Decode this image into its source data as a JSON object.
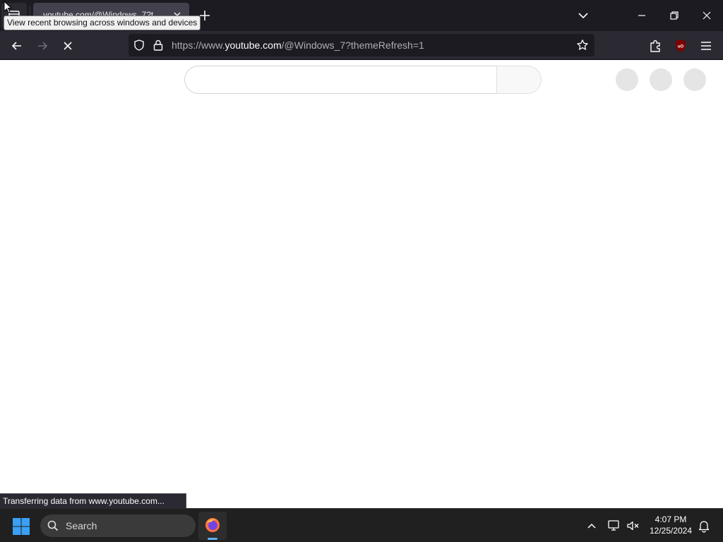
{
  "browser": {
    "tab": {
      "title": "youtube.com/@Windows_7?t"
    },
    "tooltip": "View recent browsing across windows and devices",
    "url": {
      "prefix": "https://www.",
      "host": "youtube.com",
      "path": "/@Windows_7?themeRefresh=1"
    },
    "status_text": "Transferring data from www.youtube.com..."
  },
  "taskbar": {
    "search_label": "Search",
    "time": "4:07 PM",
    "date": "12/25/2024"
  },
  "colors": {
    "tabbar_bg": "#1c1b22",
    "toolbar_bg": "#2b2a33",
    "taskbar_bg": "#202020",
    "windows_blue": "#0a84ff",
    "ublock_red": "#800000"
  }
}
